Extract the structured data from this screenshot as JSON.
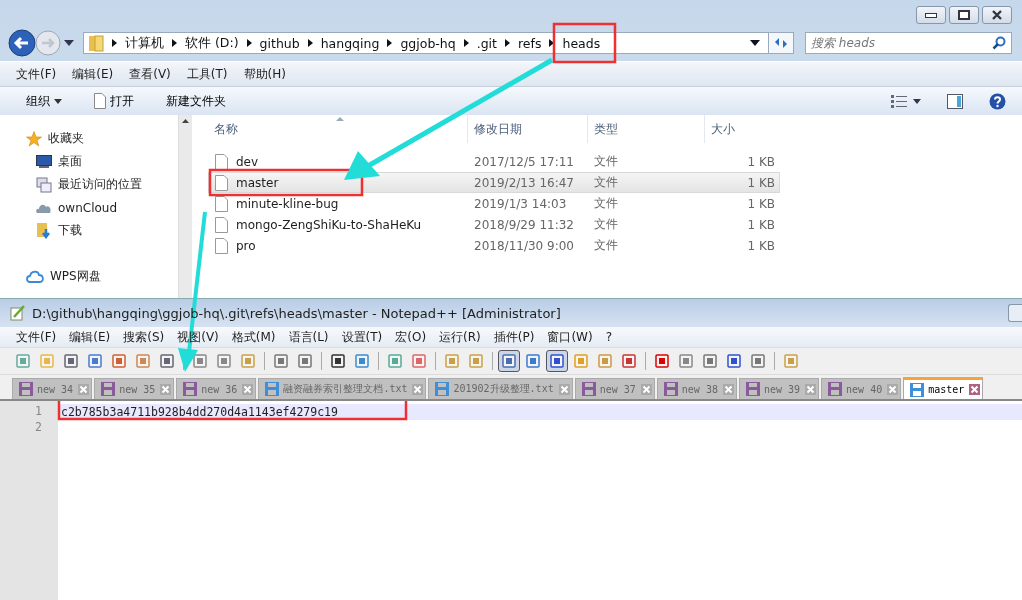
{
  "explorer": {
    "breadcrumb": [
      "计算机",
      "软件 (D:)",
      "github",
      "hangqing",
      "ggjob-hq",
      ".git",
      "refs",
      "heads"
    ],
    "search": {
      "placeholder": "搜索 heads"
    },
    "menu": [
      "文件(F)",
      "编辑(E)",
      "查看(V)",
      "工具(T)",
      "帮助(H)"
    ],
    "toolbar": {
      "organize": "组织",
      "open": "打开",
      "new_folder": "新建文件夹"
    },
    "sidebar": [
      {
        "label": "收藏夹",
        "kind": "star"
      },
      {
        "label": "桌面",
        "kind": "desktop"
      },
      {
        "label": "最近访问的位置",
        "kind": "recent"
      },
      {
        "label": "ownCloud",
        "kind": "cloud"
      },
      {
        "label": "下载",
        "kind": "download"
      },
      {
        "label": "WPS网盘",
        "kind": "wps"
      }
    ],
    "columns": [
      "名称",
      "修改日期",
      "类型",
      "大小"
    ],
    "rows": [
      {
        "name": "dev",
        "date": "2017/12/5 17:11",
        "type": "文件",
        "size": "1 KB",
        "selected": false
      },
      {
        "name": "master",
        "date": "2019/2/13 16:47",
        "type": "文件",
        "size": "1 KB",
        "selected": true
      },
      {
        "name": "minute-kline-bug",
        "date": "2019/1/3 14:03",
        "type": "文件",
        "size": "1 KB",
        "selected": false
      },
      {
        "name": "mongo-ZengShiKu-to-ShaHeKu",
        "date": "2018/9/29 11:32",
        "type": "文件",
        "size": "1 KB",
        "selected": false
      },
      {
        "name": "pro",
        "date": "2018/11/30 9:00",
        "type": "文件",
        "size": "1 KB",
        "selected": false
      }
    ]
  },
  "notepad": {
    "title": "D:\\github\\hangqing\\ggjob-hq\\.git\\refs\\heads\\master - Notepad++ [Administrator]",
    "menu": [
      "文件(F)",
      "编辑(E)",
      "搜索(S)",
      "视图(V)",
      "格式(M)",
      "语言(L)",
      "设置(T)",
      "宏(O)",
      "运行(R)",
      "插件(P)",
      "窗口(W)",
      "?"
    ],
    "toolbar": [
      {
        "pressed": false
      },
      {
        "pressed": false
      },
      {
        "pressed": false
      },
      {
        "pressed": false
      },
      {
        "pressed": false
      },
      {
        "pressed": false
      },
      {
        "pressed": false
      },
      {
        "pressed": false
      },
      {
        "pressed": false
      },
      {
        "pressed": false
      },
      {
        "pressed": false
      },
      {
        "pressed": false
      },
      {
        "pressed": false
      },
      {
        "pressed": false
      },
      {
        "pressed": false
      },
      {
        "pressed": false
      },
      {
        "pressed": false
      },
      {
        "pressed": false
      },
      {
        "pressed": true
      },
      {
        "pressed": false
      },
      {
        "pressed": true
      },
      {
        "pressed": false
      },
      {
        "pressed": false
      },
      {
        "pressed": false
      },
      {
        "pressed": false
      },
      {
        "pressed": false
      },
      {
        "pressed": false
      },
      {
        "pressed": false
      },
      {
        "pressed": false
      },
      {
        "pressed": false
      }
    ],
    "tabs": [
      {
        "label": "new 34",
        "color": "#8b5a9c",
        "selected": false
      },
      {
        "label": "new 35",
        "color": "#8b5a9c",
        "selected": false
      },
      {
        "label": "new 36",
        "color": "#8b5a9c",
        "selected": false
      },
      {
        "label": "融资融券索引整理文档.txt",
        "color": "#3f8fd8",
        "selected": false
      },
      {
        "label": "201902升级整理.txt",
        "color": "#3f8fd8",
        "selected": false
      },
      {
        "label": "new 37",
        "color": "#8b5a9c",
        "selected": false
      },
      {
        "label": "new 38",
        "color": "#8b5a9c",
        "selected": false
      },
      {
        "label": "new 39",
        "color": "#8b5a9c",
        "selected": false
      },
      {
        "label": "new 40",
        "color": "#8b5a9c",
        "selected": false
      },
      {
        "label": "master",
        "color": "#3f8fd8",
        "selected": true
      }
    ],
    "lines": [
      {
        "number": "1",
        "text": "c2b785b3a4711b928b4dd270d4a1143ef4279c19",
        "current": true
      },
      {
        "number": "2",
        "current": false
      }
    ]
  }
}
